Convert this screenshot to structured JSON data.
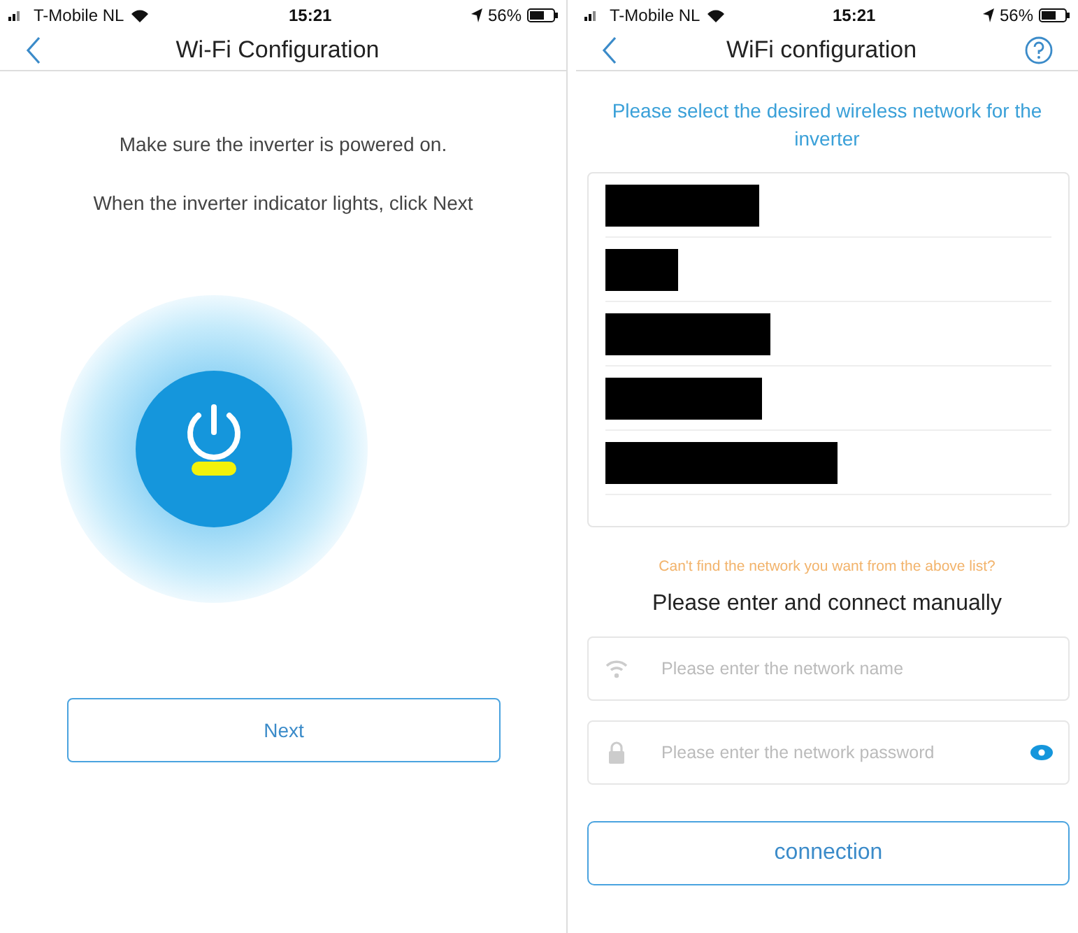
{
  "screens": [
    {
      "status_bar": {
        "carrier": "T-Mobile NL",
        "time": "15:21",
        "battery": "56%"
      },
      "nav": {
        "title": "Wi-Fi Configuration",
        "help": false
      },
      "instructions": [
        "Make sure the inverter is powered on.",
        "When the inverter indicator lights, click Next"
      ],
      "next_button": "Next"
    },
    {
      "status_bar": {
        "carrier": "T-Mobile NL",
        "time": "15:21",
        "battery": "56%"
      },
      "nav": {
        "title": "WiFi configuration",
        "help": true
      },
      "prompt": "Please select the desired wireless network for the inverter",
      "networks": [
        {
          "kind": "redacted"
        },
        {
          "kind": "redacted"
        },
        {
          "kind": "redacted"
        },
        {
          "kind": "redacted"
        },
        {
          "kind": "redacted"
        }
      ],
      "hint": "Can't find the network you want from the above list?",
      "manual_label": "Please  enter and connect manually",
      "name_field": {
        "placeholder": "Please enter the network name"
      },
      "password_field": {
        "placeholder": "Please enter the network password"
      },
      "connect_button": "connection"
    }
  ]
}
